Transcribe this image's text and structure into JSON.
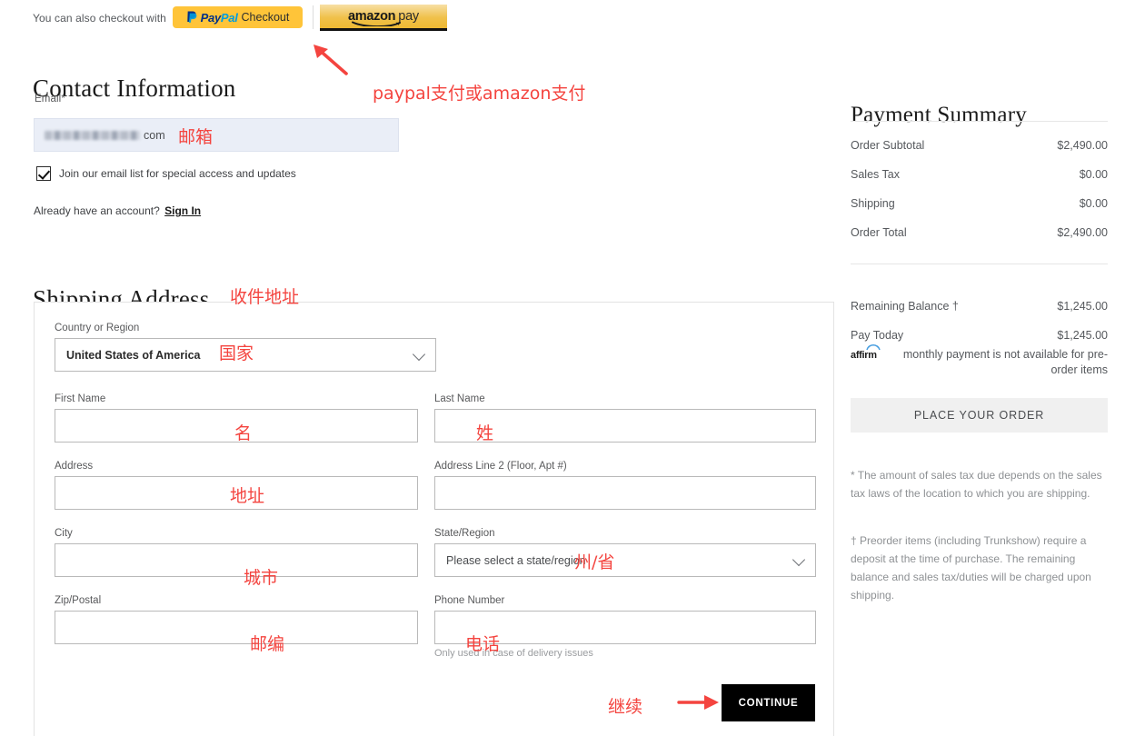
{
  "express": {
    "label": "You can also checkout with",
    "paypal": {
      "brand_pal": "Pal",
      "brand_pay": "Pay",
      "suffix": "Checkout"
    },
    "amazon": {
      "word": "amazon",
      "pay": "pay"
    }
  },
  "contact": {
    "heading": "Contact Information",
    "email_label": "Email*",
    "email_value_visible": "com",
    "newsletter_label": "Join our email list for special access and updates",
    "account_prompt": "Already have an account?",
    "signin_label": "Sign In"
  },
  "shipping": {
    "heading": "Shipping Address",
    "fields": {
      "country": {
        "label": "Country or Region",
        "value": "United States of America"
      },
      "first_name": {
        "label": "First Name",
        "value": ""
      },
      "last_name": {
        "label": "Last Name",
        "value": ""
      },
      "address": {
        "label": "Address",
        "value": ""
      },
      "address2": {
        "label": "Address Line 2 (Floor, Apt #)",
        "value": ""
      },
      "city": {
        "label": "City",
        "value": ""
      },
      "state": {
        "label": "State/Region",
        "value": "Please select a state/region"
      },
      "zip": {
        "label": "Zip/Postal",
        "value": ""
      },
      "phone": {
        "label": "Phone Number",
        "value": "",
        "helper": "Only used in case of delivery issues"
      }
    },
    "continue_label": "CONTINUE"
  },
  "payment_summary": {
    "heading": "Payment Summary",
    "rows": [
      {
        "label": "Order Subtotal",
        "amount": "$2,490.00"
      },
      {
        "label": "Sales Tax",
        "amount": "$0.00"
      },
      {
        "label": "Shipping",
        "amount": "$0.00"
      },
      {
        "label": "Order Total",
        "amount": "$2,490.00"
      },
      {
        "label": "Remaining Balance †",
        "amount": "$1,245.00"
      },
      {
        "label": "Pay Today",
        "amount": "$1,245.00"
      }
    ],
    "affirm_brand": "affirm",
    "affirm_note": "monthly payment is not available for pre-order items",
    "place_order_label": "PLACE YOUR ORDER",
    "footnote_tax": "* The amount of sales tax due depends on the sales tax laws of the location to which you are shipping.",
    "footnote_preorder": "† Preorder items (including Trunkshow) require a deposit at the time of purchase. The remaining balance and sales tax/duties will be charged upon shipping."
  },
  "annotations": {
    "payment_methods": "paypal支付或amazon支付",
    "email": "邮箱",
    "shipping_address": "收件地址",
    "country": "国家",
    "first_name": "名",
    "last_name": "姓",
    "address": "地址",
    "city": "城市",
    "state": "州/省",
    "zip": "邮编",
    "phone": "电话",
    "continue": "继续",
    "color": "#f4443f"
  }
}
